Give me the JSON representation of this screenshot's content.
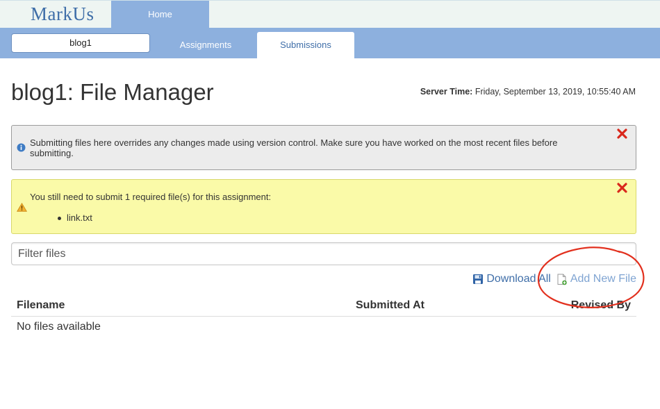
{
  "app": {
    "logo_text": "MarkUs"
  },
  "top_nav": {
    "home_label": "Home"
  },
  "nav": {
    "course_selector_value": "blog1",
    "tabs": [
      {
        "label": "Assignments",
        "active": false
      },
      {
        "label": "Submissions",
        "active": true
      }
    ]
  },
  "page": {
    "title": "blog1: File Manager",
    "server_time_label": "Server Time:",
    "server_time_value": "Friday, September 13, 2019, 10:55:40 AM"
  },
  "notices": {
    "info": {
      "text": "Submitting files here overrides any changes made using version control. Make sure you have worked on the most recent files before submitting.",
      "icon": "info-icon"
    },
    "warning": {
      "text": "You still need to submit 1 required file(s) for this assignment:",
      "icon": "warning-icon",
      "required_files": [
        "link.txt"
      ]
    }
  },
  "filter": {
    "placeholder": "Filter files"
  },
  "actions": {
    "download_all_label": "Download All",
    "add_new_file_label": "Add New File"
  },
  "table": {
    "headers": [
      "Filename",
      "Submitted At",
      "Revised By"
    ],
    "empty_text": "No files available"
  },
  "colors": {
    "nav_blue": "#8db0de",
    "link_blue": "#3f6ea8",
    "warning_bg": "#fafaa8",
    "info_bg": "#ececec",
    "annotation_red": "#e2301e"
  }
}
